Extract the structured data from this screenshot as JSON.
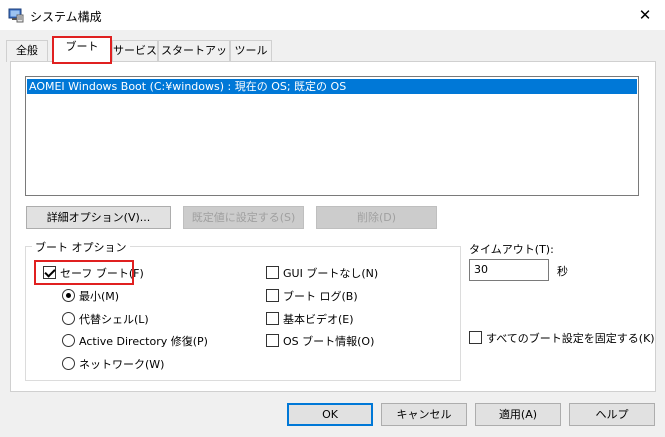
{
  "window": {
    "title": "システム構成",
    "close_glyph": "✕"
  },
  "tabs": [
    {
      "label": "全般",
      "active": false
    },
    {
      "label": "ブート",
      "active": true
    },
    {
      "label": "サービス",
      "active": false
    },
    {
      "label": "スタートアップ",
      "active": false
    },
    {
      "label": "ツール",
      "active": false
    }
  ],
  "os_list": [
    "AOMEI Windows Boot (C:¥windows) : 現在の OS; 既定の OS"
  ],
  "os_buttons": {
    "advanced": "詳細オプション(V)...",
    "set_default": "既定値に設定する(S)",
    "delete": "削除(D)"
  },
  "boot_options": {
    "group_label": "ブート オプション",
    "safe_boot": {
      "label": "セーフ ブート(F)",
      "checked": true
    },
    "modes": [
      {
        "label": "最小(M)",
        "selected": true
      },
      {
        "label": "代替シェル(L)",
        "selected": false
      },
      {
        "label": "Active Directory 修復(P)",
        "selected": false
      },
      {
        "label": "ネットワーク(W)",
        "selected": false
      }
    ],
    "right_checks": [
      {
        "label": "GUI ブートなし(N)",
        "checked": false
      },
      {
        "label": "ブート ログ(B)",
        "checked": false
      },
      {
        "label": "基本ビデオ(E)",
        "checked": false
      },
      {
        "label": "OS ブート情報(O)",
        "checked": false
      }
    ]
  },
  "timeout": {
    "label": "タイムアウト(T):",
    "value": "30",
    "unit": "秒"
  },
  "permanent": {
    "label": "すべてのブート設定を固定する(K)",
    "checked": false
  },
  "footer_buttons": {
    "ok": "OK",
    "cancel": "キャンセル",
    "apply": "適用(A)",
    "help": "ヘルプ"
  },
  "colors": {
    "selection": "#0078d7",
    "highlight_box": "#e02020"
  }
}
